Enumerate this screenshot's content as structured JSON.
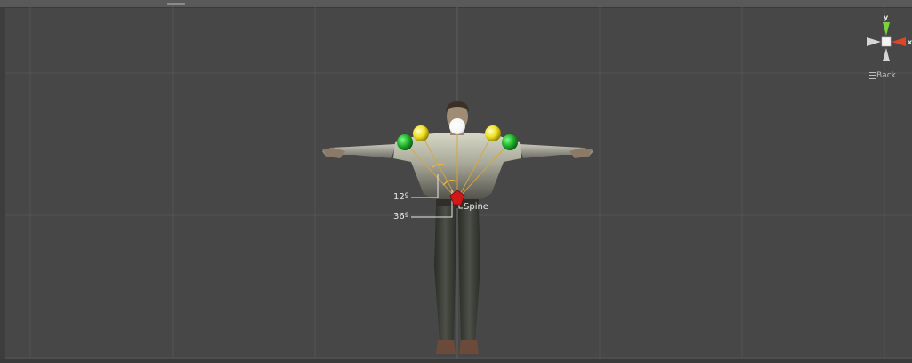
{
  "scene_view": {
    "angle_labels": {
      "first": "12º",
      "second": "36º"
    },
    "bone_label": "Spine",
    "gizmo": {
      "axis_y": "y",
      "axis_x": "x",
      "view_name": "Back"
    }
  },
  "colors": {
    "background": "#474747",
    "grid": "#545454",
    "handle_green": "#1fb02a",
    "handle_yellow": "#f0e020",
    "handle_white": "#ffffff",
    "selected_bone": "#d01818",
    "arc": "#d9a63a",
    "axis_y": "#7bd33b",
    "axis_x": "#e0452a"
  },
  "icons": {
    "view_menu": "hamburger-icon",
    "orientation_gizmo": "axis-gizmo-icon"
  }
}
